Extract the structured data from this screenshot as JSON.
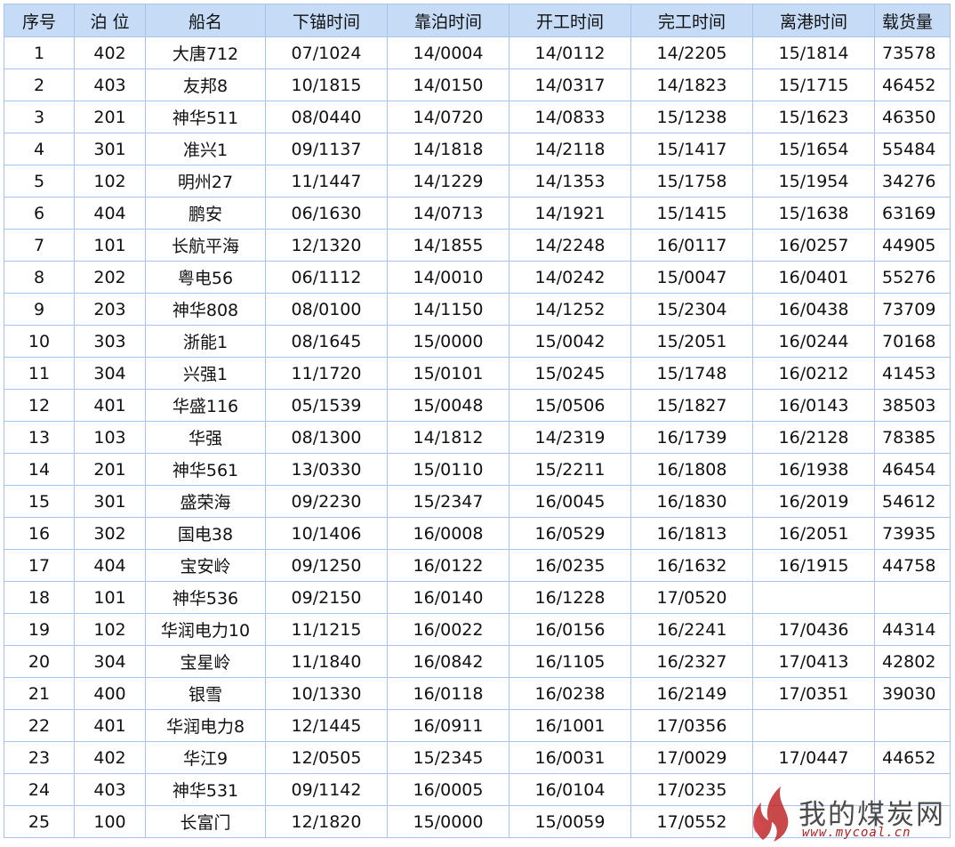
{
  "headers": [
    "序号",
    "泊 位",
    "船名",
    "下锚时间",
    "靠泊时间",
    "开工时间",
    "完工时间",
    "离港时间",
    "载货量"
  ],
  "rows": [
    [
      "1",
      "402",
      "大唐712",
      "07/1024",
      "14/0004",
      "14/0112",
      "14/2205",
      "15/1814",
      "73578"
    ],
    [
      "2",
      "403",
      "友邦8",
      "10/1815",
      "14/0150",
      "14/0317",
      "14/1823",
      "15/1715",
      "46452"
    ],
    [
      "3",
      "201",
      "神华511",
      "08/0440",
      "14/0720",
      "14/0833",
      "15/1238",
      "15/1623",
      "46350"
    ],
    [
      "4",
      "301",
      "准兴1",
      "09/1137",
      "14/1818",
      "14/2118",
      "15/1417",
      "15/1654",
      "55484"
    ],
    [
      "5",
      "102",
      "明州27",
      "11/1447",
      "14/1229",
      "14/1353",
      "15/1758",
      "15/1954",
      "34276"
    ],
    [
      "6",
      "404",
      "鹏安",
      "06/1630",
      "14/0713",
      "14/1921",
      "15/1415",
      "15/1638",
      "63169"
    ],
    [
      "7",
      "101",
      "长航平海",
      "12/1320",
      "14/1855",
      "14/2248",
      "16/0117",
      "16/0257",
      "44905"
    ],
    [
      "8",
      "202",
      "粤电56",
      "06/1112",
      "14/0010",
      "14/0242",
      "15/0047",
      "16/0401",
      "55276"
    ],
    [
      "9",
      "203",
      "神华808",
      "08/0100",
      "14/1150",
      "14/1252",
      "15/2304",
      "16/0438",
      "73709"
    ],
    [
      "10",
      "303",
      "浙能1",
      "08/1645",
      "15/0000",
      "15/0042",
      "15/2051",
      "16/0244",
      "70168"
    ],
    [
      "11",
      "304",
      "兴强1",
      "11/1720",
      "15/0101",
      "15/0245",
      "15/1748",
      "16/0212",
      "41453"
    ],
    [
      "12",
      "401",
      "华盛116",
      "05/1539",
      "15/0048",
      "15/0506",
      "15/1827",
      "16/0143",
      "38503"
    ],
    [
      "13",
      "103",
      "华强",
      "08/1300",
      "14/1812",
      "14/2319",
      "16/1739",
      "16/2128",
      "78385"
    ],
    [
      "14",
      "201",
      "神华561",
      "13/0330",
      "15/0110",
      "15/2211",
      "16/1808",
      "16/1938",
      "46454"
    ],
    [
      "15",
      "301",
      "盛荣海",
      "09/2230",
      "15/2347",
      "16/0045",
      "16/1830",
      "16/2019",
      "54612"
    ],
    [
      "16",
      "302",
      "国电38",
      "10/1406",
      "16/0008",
      "16/0529",
      "16/1813",
      "16/2051",
      "73935"
    ],
    [
      "17",
      "404",
      "宝安岭",
      "09/1250",
      "16/0122",
      "16/0235",
      "16/1632",
      "16/1915",
      "44758"
    ],
    [
      "18",
      "101",
      "神华536",
      "09/2150",
      "16/0140",
      "16/1228",
      "17/0520",
      "",
      ""
    ],
    [
      "19",
      "102",
      "华润电力10",
      "11/1215",
      "16/0022",
      "16/0156",
      "16/2241",
      "17/0436",
      "44314"
    ],
    [
      "20",
      "304",
      "宝星岭",
      "11/1840",
      "16/0842",
      "16/1105",
      "16/2327",
      "17/0413",
      "42802"
    ],
    [
      "21",
      "400",
      "银雪",
      "10/1330",
      "16/0118",
      "16/0238",
      "16/2149",
      "17/0351",
      "39030"
    ],
    [
      "22",
      "401",
      "华润电力8",
      "12/1445",
      "16/0911",
      "16/1001",
      "17/0356",
      "",
      ""
    ],
    [
      "23",
      "402",
      "华江9",
      "12/0505",
      "15/2345",
      "16/0031",
      "17/0029",
      "17/0447",
      "44652"
    ],
    [
      "24",
      "403",
      "神华531",
      "09/1142",
      "16/0005",
      "16/0104",
      "17/0235",
      "",
      ""
    ],
    [
      "25",
      "100",
      "长富门",
      "12/1820",
      "15/0000",
      "15/0059",
      "17/0552",
      "",
      ""
    ]
  ],
  "watermark": {
    "title": "我的煤炭网",
    "url": "www.mycoal.cn",
    "logo_icon": "flame-logo-icon",
    "logo_color": "#c0282a"
  }
}
